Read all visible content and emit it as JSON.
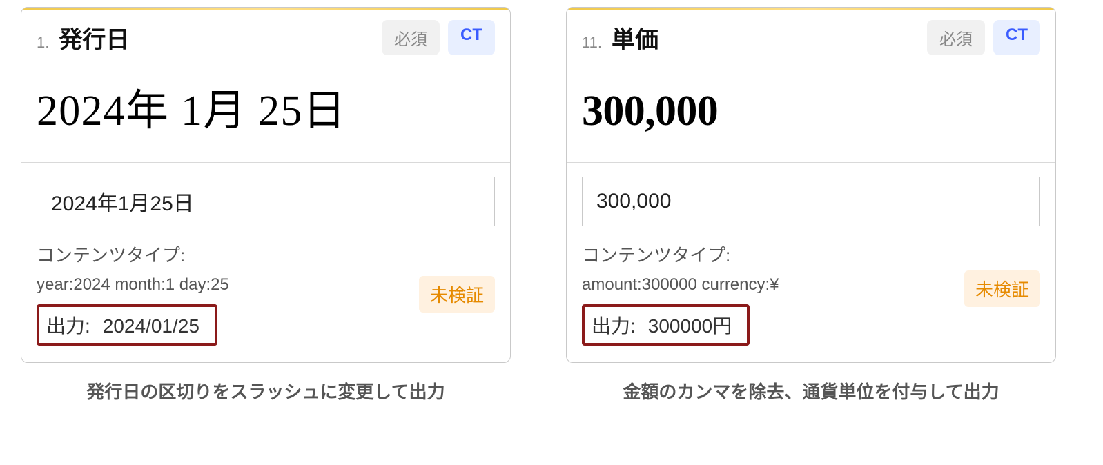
{
  "cards": [
    {
      "number": "1.",
      "title": "発行日",
      "badge_required": "必須",
      "badge_ct": "CT",
      "extracted_value": "2024年 1月 25日",
      "input_value": "2024年1月25日",
      "content_type_label": "コンテンツタイプ:",
      "content_type_detail": "year:2024   month:1   day:25",
      "status": "未検証",
      "output_label": "出力:",
      "output_value": "2024/01/25",
      "caption": "発行日の区切りをスラッシュに変更して出力"
    },
    {
      "number": "11.",
      "title": "単価",
      "badge_required": "必須",
      "badge_ct": "CT",
      "extracted_value": "300,000",
      "input_value": "300,000",
      "content_type_label": "コンテンツタイプ:",
      "content_type_detail": "amount:300000   currency:¥",
      "status": "未検証",
      "output_label": "出力:",
      "output_value": "300000円",
      "caption": "金額のカンマを除去、通貨単位を付与して出力"
    }
  ]
}
